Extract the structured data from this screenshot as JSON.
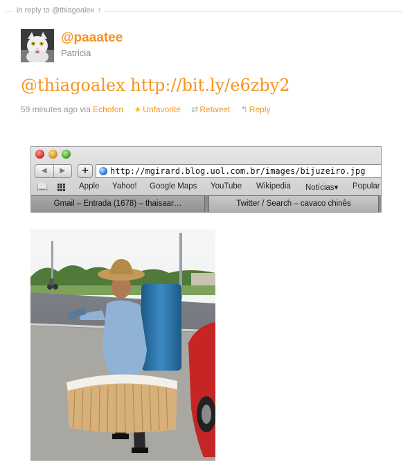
{
  "reply": {
    "label": "in reply to @thiagoalex",
    "arrow": "↑"
  },
  "user": {
    "screen_name": "@paaatee",
    "full_name": "Patricia",
    "avatar_icon": "cat-avatar"
  },
  "tweet": {
    "mention": "@thiagoalex",
    "link": "http://bit.ly/e6zby2"
  },
  "meta": {
    "time": "59 minutes ago",
    "via": "via",
    "client": "Echofon",
    "unfavorite": "Unfavorite",
    "retweet": "Retweet",
    "reply": "Reply"
  },
  "browser": {
    "url": "http://mgirard.blog.uol.com.br/images/bijuzeiro.jpg",
    "bookmarks": [
      "Apple",
      "Yahoo!",
      "Google Maps",
      "YouTube",
      "Wikipedia",
      "Notícias▾",
      "Popular"
    ],
    "tabs": [
      "Gmail – Entrada (1678) – thaisaar…",
      "Twitter / Search – cavaco chinês"
    ]
  },
  "colors": {
    "accent": "#f7931e",
    "meta_gray": "#999999"
  }
}
